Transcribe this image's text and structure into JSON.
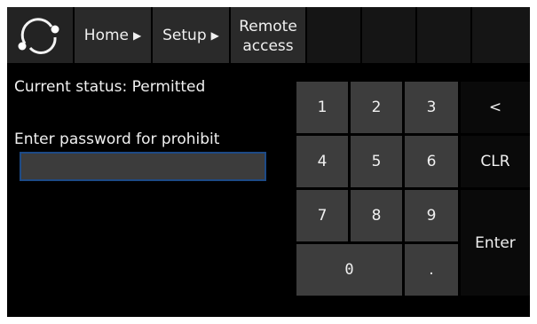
{
  "header": {
    "logo": "refresh-arc-icon",
    "breadcrumb": [
      {
        "label": "Home",
        "arrow": "▶"
      },
      {
        "label": "Setup",
        "arrow": "▶"
      },
      {
        "label_line1": "Remote",
        "label_line2": "access"
      }
    ]
  },
  "main": {
    "status_text": "Current status: Permitted",
    "prompt_text": "Enter password for prohibit",
    "password_value": ""
  },
  "keypad": {
    "keys": [
      "1",
      "2",
      "3",
      "4",
      "5",
      "6",
      "7",
      "8",
      "9",
      "0",
      "."
    ],
    "backspace": "<",
    "clear": "CLR",
    "enter": "Enter"
  },
  "colors": {
    "background": "#000000",
    "key_fill": "#3d3d3d",
    "input_border": "#1d4a86",
    "text": "#f0f0f0"
  }
}
